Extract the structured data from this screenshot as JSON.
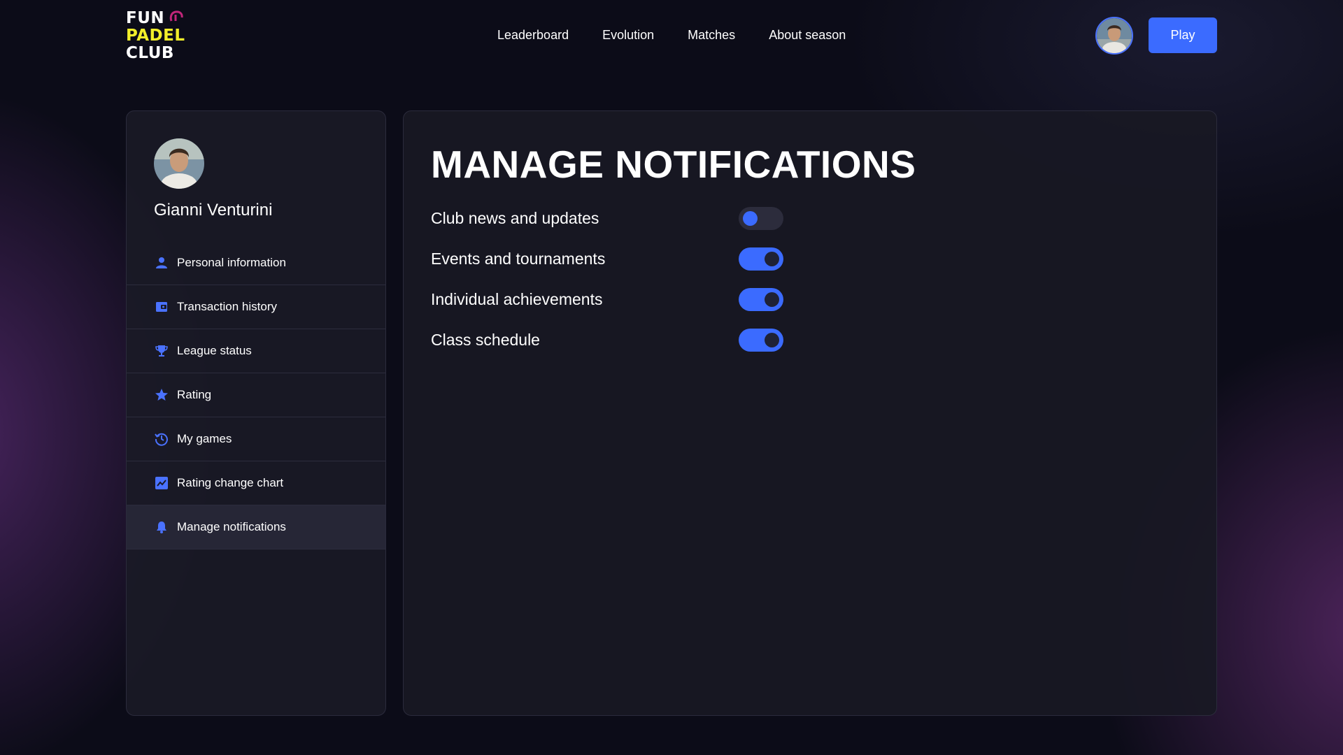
{
  "app": {
    "logo_lines": [
      "FUN",
      "PADEL",
      "CLUB"
    ]
  },
  "nav": {
    "items": [
      {
        "label": "Leaderboard"
      },
      {
        "label": "Evolution"
      },
      {
        "label": "Matches"
      },
      {
        "label": "About season"
      }
    ],
    "play_label": "Play"
  },
  "profile": {
    "name": "Gianni Venturini"
  },
  "sidebar": {
    "items": [
      {
        "label": "Personal information",
        "icon": "user-icon"
      },
      {
        "label": "Transaction history",
        "icon": "wallet-icon"
      },
      {
        "label": "League status",
        "icon": "trophy-icon"
      },
      {
        "label": "Rating",
        "icon": "star-icon"
      },
      {
        "label": "My games",
        "icon": "history-icon"
      },
      {
        "label": "Rating change chart",
        "icon": "chart-icon"
      },
      {
        "label": "Manage notifications",
        "icon": "bell-icon",
        "active": true
      }
    ]
  },
  "main": {
    "title": "MANAGE NOTIFICATIONS",
    "preferences": [
      {
        "label": "Club news and updates",
        "enabled": false
      },
      {
        "label": "Events and tournaments",
        "enabled": true
      },
      {
        "label": "Individual achievements",
        "enabled": true
      },
      {
        "label": "Class schedule",
        "enabled": true
      }
    ]
  },
  "colors": {
    "accent": "#3b6bff",
    "logo_yellow": "#f2ee2a",
    "logo_magenta": "#c2267a",
    "background": "#0c0c18",
    "panel": "#1a1a26"
  }
}
